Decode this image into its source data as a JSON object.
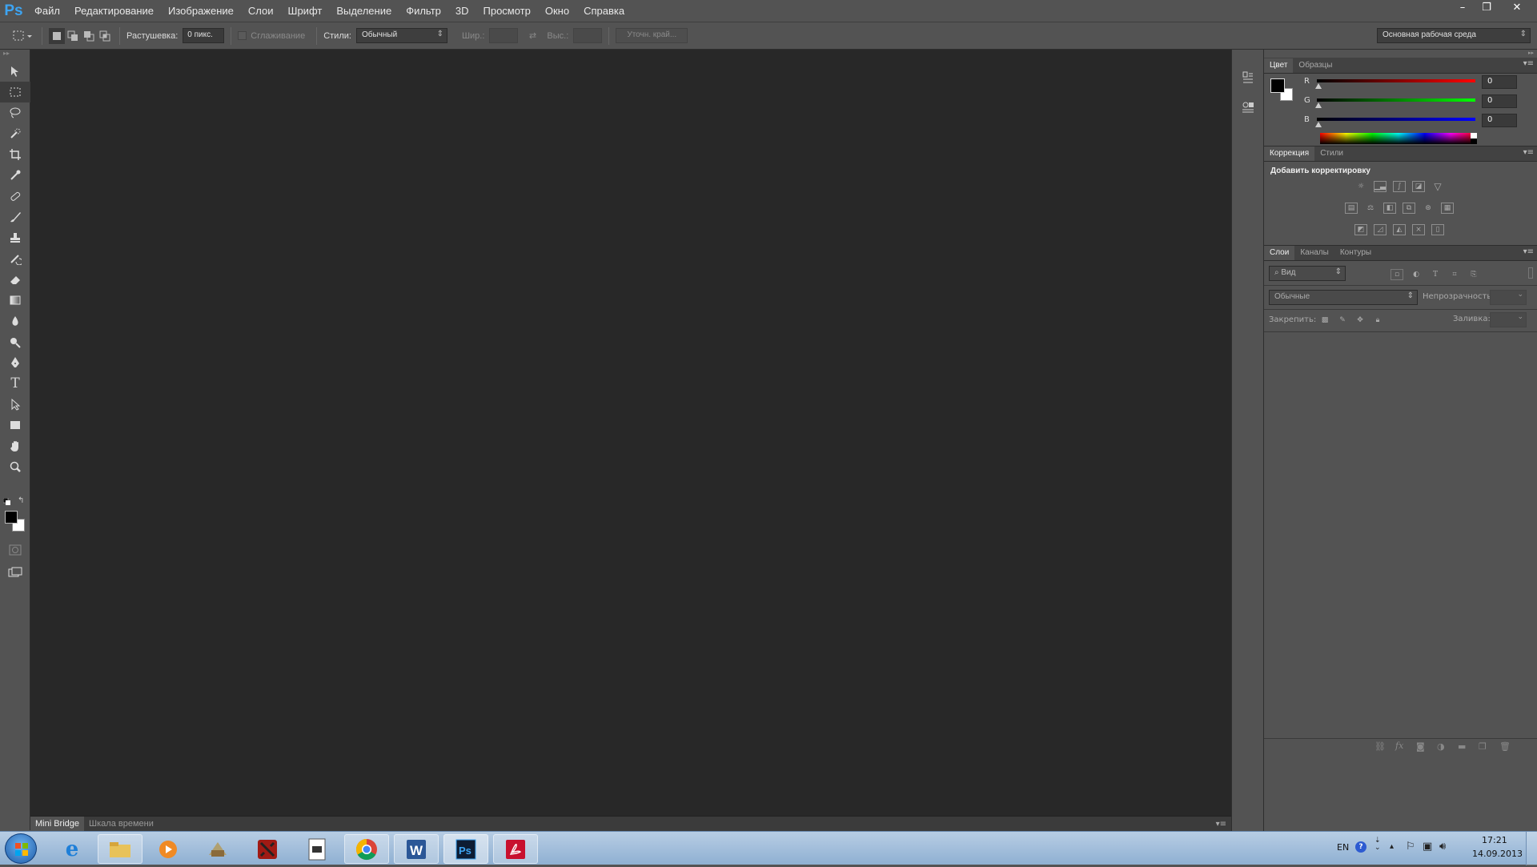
{
  "app": {
    "logo": "Ps"
  },
  "menu": [
    "Файл",
    "Редактирование",
    "Изображение",
    "Слои",
    "Шрифт",
    "Выделение",
    "Фильтр",
    "3D",
    "Просмотр",
    "Окно",
    "Справка"
  ],
  "window_controls": {
    "minimize": "–",
    "restore": "❐",
    "close": "✕"
  },
  "options": {
    "feather_label": "Растушевка:",
    "feather_value": "0 пикс.",
    "antialias_label": "Сглаживание",
    "style_label": "Стили:",
    "style_value": "Обычный",
    "width_label": "Шир.:",
    "height_label": "Выс.:",
    "refine_label": "Уточн. край...",
    "workspace_value": "Основная рабочая среда"
  },
  "bottom_tabs": [
    "Mini Bridge",
    "Шкала времени"
  ],
  "color_panel": {
    "tabs": [
      "Цвет",
      "Образцы"
    ],
    "channels": [
      {
        "label": "R",
        "value": "0",
        "color": "#e02020"
      },
      {
        "label": "G",
        "value": "0",
        "color": "#20c020"
      },
      {
        "label": "B",
        "value": "0",
        "color": "#2040e0"
      }
    ]
  },
  "adjust_panel": {
    "tabs": [
      "Коррекция",
      "Стили"
    ],
    "heading": "Добавить корректировку"
  },
  "layers_panel": {
    "tabs": [
      "Слои",
      "Каналы",
      "Контуры"
    ],
    "filter_value": "Вид",
    "blend_value": "Обычные",
    "opacity_label": "Непрозрачность:",
    "lock_label": "Закрепить:",
    "fill_label": "Заливка:"
  },
  "taskbar": {
    "lang": "EN",
    "time": "17:21",
    "date": "14.09.2013"
  },
  "colors": {
    "accent": "#3da4f2",
    "workspace": "#282828",
    "panel": "#535353"
  }
}
